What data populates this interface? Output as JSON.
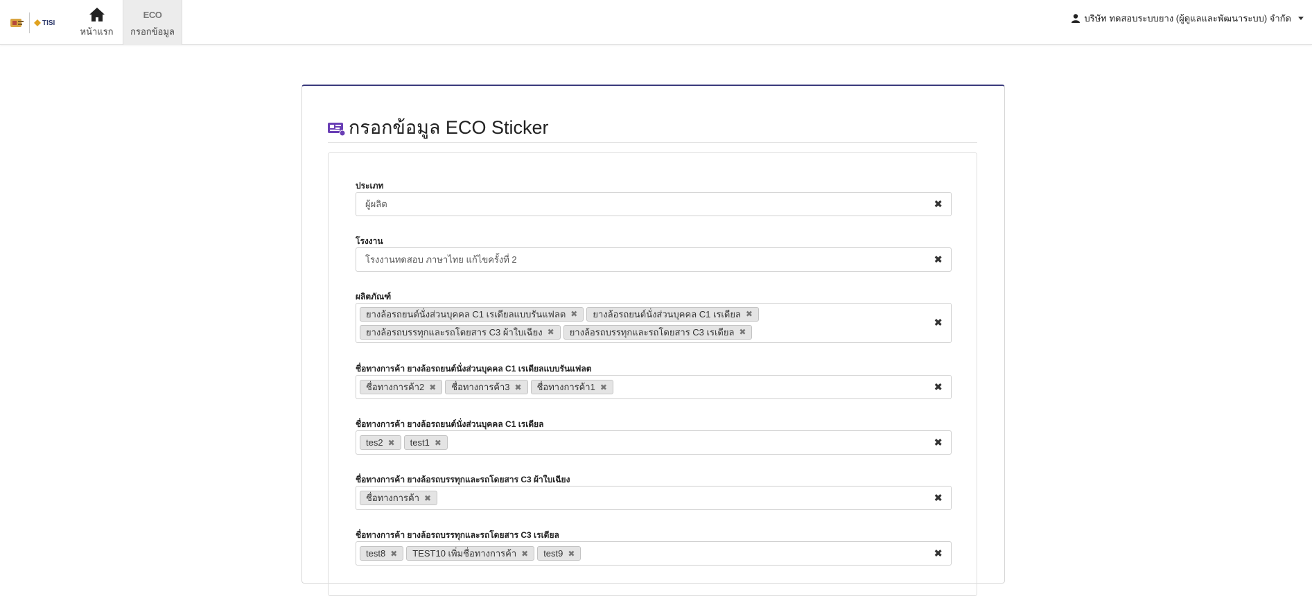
{
  "nav": {
    "brand_text": "TISI",
    "home_label": "หน้าแรก",
    "eco_glyph": "ECO",
    "eco_label": "กรอกข้อมูล",
    "user_name": "บริษัท ทดสอบระบบยาง (ผู้ดูแลและพัฒนาระบบ) จำกัด"
  },
  "page": {
    "title": "กรอกข้อมูล ECO Sticker",
    "accent_color": "#6a3fb5"
  },
  "form": {
    "clear_glyph": "✖",
    "tag_remove_glyph": "✖",
    "type": {
      "label": "ประเภท",
      "value": "ผู้ผลิต"
    },
    "factory": {
      "label": "โรงงาน",
      "value": "โรงงานทดสอบ ภาษาไทย แก้ไขครั้งที่ 2"
    },
    "products": {
      "label": "ผลิตภัณฑ์",
      "tags": [
        "ยางล้อรถยนต์นั่งส่วนบุคคล C1 เรเดียลแบบรันแฟลต",
        "ยางล้อรถยนต์นั่งส่วนบุคคล C1 เรเดียล",
        "ยางล้อรถบรรทุกและรถโดยสาร C3 ผ้าใบเฉียง",
        "ยางล้อรถบรรทุกและรถโดยสาร C3 เรเดียล"
      ]
    },
    "brand_c1_runflat": {
      "label": "ชื่อทางการค้า ยางล้อรถยนต์นั่งส่วนบุคคล C1 เรเดียลแบบรันแฟลต",
      "tags": [
        "ชื่อทางการค้า2",
        "ชื่อทางการค้า3",
        "ชื่อทางการค้า1"
      ]
    },
    "brand_c1_radial": {
      "label": "ชื่อทางการค้า ยางล้อรถยนต์นั่งส่วนบุคคล C1 เรเดียล",
      "tags": [
        "tes2",
        "test1"
      ]
    },
    "brand_c3_bias": {
      "label": "ชื่อทางการค้า ยางล้อรถบรรทุกและรถโดยสาร C3 ผ้าใบเฉียง",
      "tags": [
        "ชื่อทางการค้า"
      ]
    },
    "brand_c3_radial": {
      "label": "ชื่อทางการค้า ยางล้อรถบรรทุกและรถโดยสาร C3 เรเดียล",
      "tags": [
        "test8",
        "TEST10 เพิ่มชื่อทางการค้า",
        "test9"
      ]
    }
  }
}
